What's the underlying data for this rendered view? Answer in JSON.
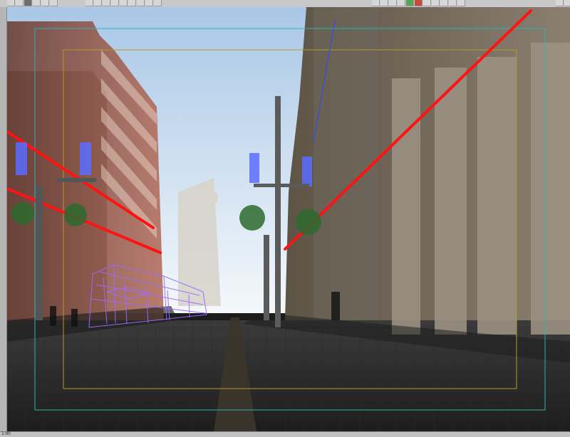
{
  "status_bar": {
    "coord_readout": "1:00"
  },
  "colors": {
    "safe_frame_outer": "#2fb3b0",
    "safe_frame_inner": "#b79a2a",
    "spline_red": "#ff1212",
    "wireframe_purple": "#9b6bff"
  },
  "icons": [
    "toolbar-icons",
    "street-lamp-icon",
    "wireframe-vehicle-icon"
  ]
}
